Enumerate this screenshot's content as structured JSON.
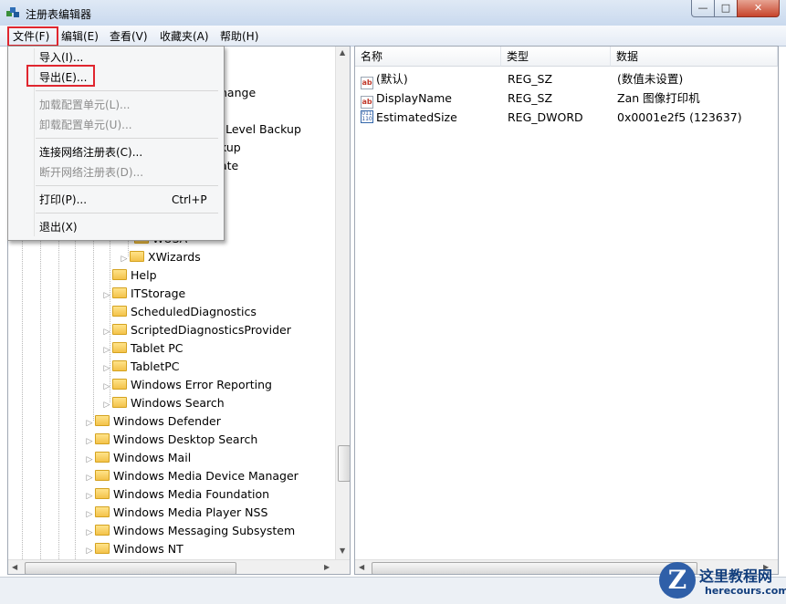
{
  "window": {
    "title": "注册表编辑器",
    "min_glyph": "—",
    "max_glyph": "□",
    "close_glyph": "✕"
  },
  "menubar": [
    "文件(F)",
    "编辑(E)",
    "查看(V)",
    "收藏夹(A)",
    "帮助(H)"
  ],
  "file_menu": {
    "items": [
      {
        "label": "导入(I)...",
        "shortcut": "",
        "enabled": true
      },
      {
        "label": "导出(E)...",
        "shortcut": "",
        "enabled": true
      },
      {
        "label": "加载配置单元(L)...",
        "shortcut": "",
        "enabled": false
      },
      {
        "label": "卸载配置单元(U)...",
        "shortcut": "",
        "enabled": false
      },
      {
        "label": "连接网络注册表(C)...",
        "shortcut": "",
        "enabled": true
      },
      {
        "label": "断开网络注册表(D)...",
        "shortcut": "",
        "enabled": false
      },
      {
        "label": "打印(P)...",
        "shortcut": "Ctrl+P",
        "enabled": true
      },
      {
        "label": "退出(X)",
        "shortcut": "",
        "enabled": true
      }
    ]
  },
  "tree": {
    "partial_visible": [
      "hange",
      "ck Level Backup",
      "kup",
      "ate",
      "WUSA"
    ],
    "items": [
      {
        "label": "XWizards",
        "expandable": true
      },
      {
        "label": "Help",
        "expandable": false
      },
      {
        "label": "ITStorage",
        "expandable": true
      },
      {
        "label": "ScheduledDiagnostics",
        "expandable": false
      },
      {
        "label": "ScriptedDiagnosticsProvider",
        "expandable": true
      },
      {
        "label": "Tablet PC",
        "expandable": true
      },
      {
        "label": "TabletPC",
        "expandable": true
      },
      {
        "label": "Windows Error Reporting",
        "expandable": true
      },
      {
        "label": "Windows Search",
        "expandable": true
      },
      {
        "label": "Windows Defender",
        "expandable": true
      },
      {
        "label": "Windows Desktop Search",
        "expandable": true
      },
      {
        "label": "Windows Mail",
        "expandable": true
      },
      {
        "label": "Windows Media Device Manager",
        "expandable": true
      },
      {
        "label": "Windows Media Foundation",
        "expandable": true
      },
      {
        "label": "Windows Media Player NSS",
        "expandable": true
      },
      {
        "label": "Windows Messaging Subsystem",
        "expandable": true
      },
      {
        "label": "Windows NT",
        "expandable": true
      }
    ]
  },
  "values_pane": {
    "columns": [
      "名称",
      "类型",
      "数据"
    ],
    "rows": [
      {
        "icon": "string-value-icon",
        "name": "(默认)",
        "type": "REG_SZ",
        "data": "(数值未设置)"
      },
      {
        "icon": "string-value-icon",
        "name": "DisplayName",
        "type": "REG_SZ",
        "data": "Zan 图像打印机"
      },
      {
        "icon": "binary-value-icon",
        "name": "EstimatedSize",
        "type": "REG_DWORD",
        "data": "0x0001e2f5 (123637)"
      }
    ]
  },
  "watermark": {
    "logo_letter": "Z",
    "text_cn": "这里教程网",
    "text_en": "herecours.com"
  },
  "colors": {
    "highlight_box": "#e0262f",
    "disabled_text": "#8d8d8d"
  }
}
